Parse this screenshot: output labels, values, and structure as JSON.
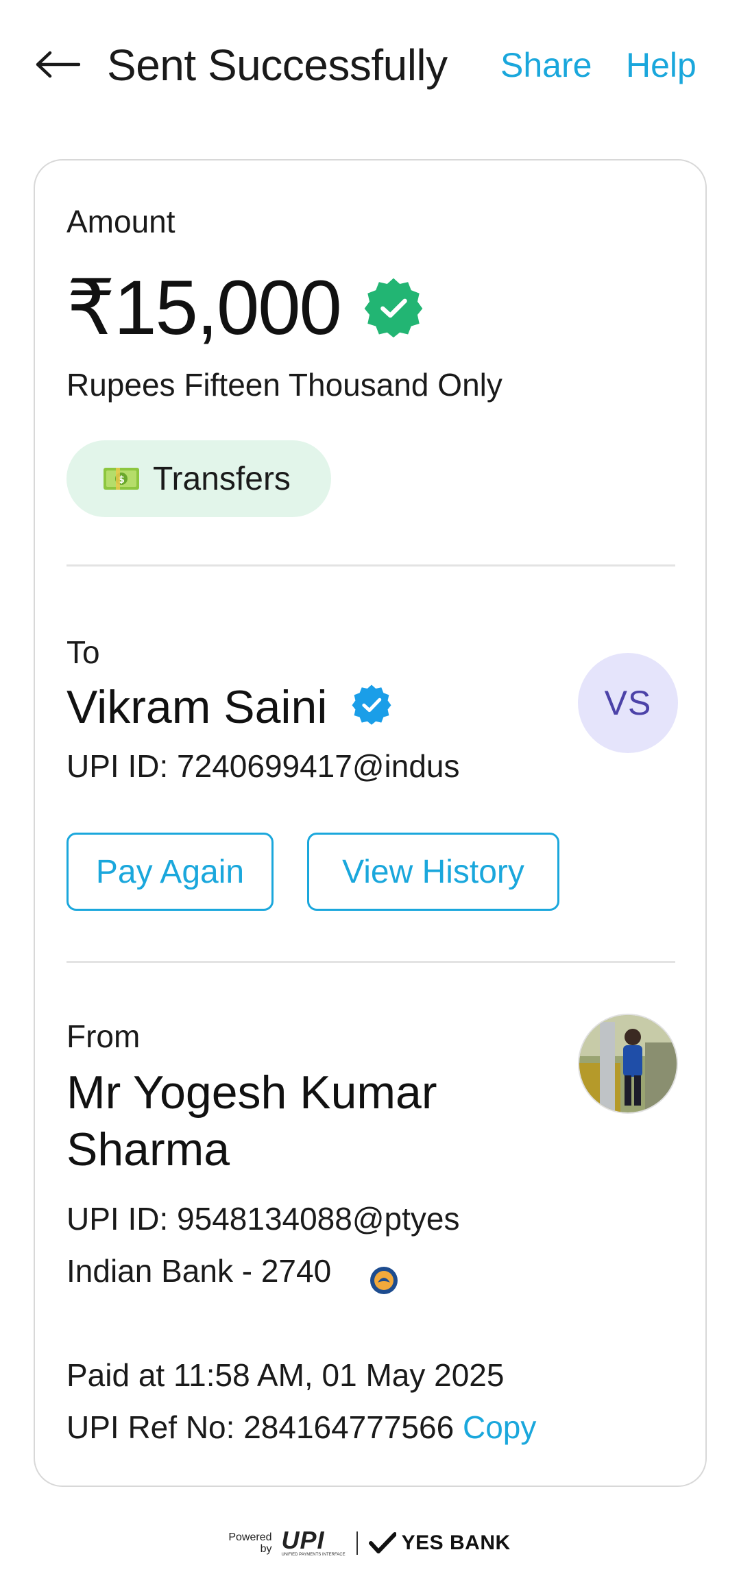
{
  "header": {
    "title": "Sent Successfully",
    "share_label": "Share",
    "help_label": "Help"
  },
  "amount_section": {
    "label": "Amount",
    "amount": "₹15,000",
    "amount_words": "Rupees Fifteen Thousand Only",
    "category_icon": "money-icon",
    "category": "Transfers"
  },
  "to_section": {
    "label": "To",
    "name": "Vikram Saini",
    "upi_id": "UPI ID: 7240699417@indus",
    "initials": "VS",
    "pay_again_label": "Pay Again",
    "view_history_label": "View History"
  },
  "from_section": {
    "label": "From",
    "name_line1": "Mr Yogesh Kumar",
    "name_line2": "Sharma",
    "upi_id": "UPI ID: 9548134088@ptyes",
    "bank": "Indian Bank - 2740",
    "bank_icon": "indian-bank-logo-icon"
  },
  "transaction": {
    "paid_at": "Paid at 11:58 AM, 01 May 2025",
    "ref_no": "UPI Ref No: 284164777566",
    "copy_label": "Copy"
  },
  "footer": {
    "powered_line1": "Powered",
    "powered_line2": "by",
    "upi_text": "UPI",
    "upi_subtext": "UNIFIED PAYMENTS INTERFACE",
    "bank_brand": "YES BANK"
  },
  "colors": {
    "accent": "#1aa7dc",
    "success_green": "#22b573",
    "verified_blue": "#1a9ee8",
    "tag_bg": "#e2f5ea",
    "avatar_bg": "#e5e4fb",
    "avatar_text": "#4c42a8"
  }
}
